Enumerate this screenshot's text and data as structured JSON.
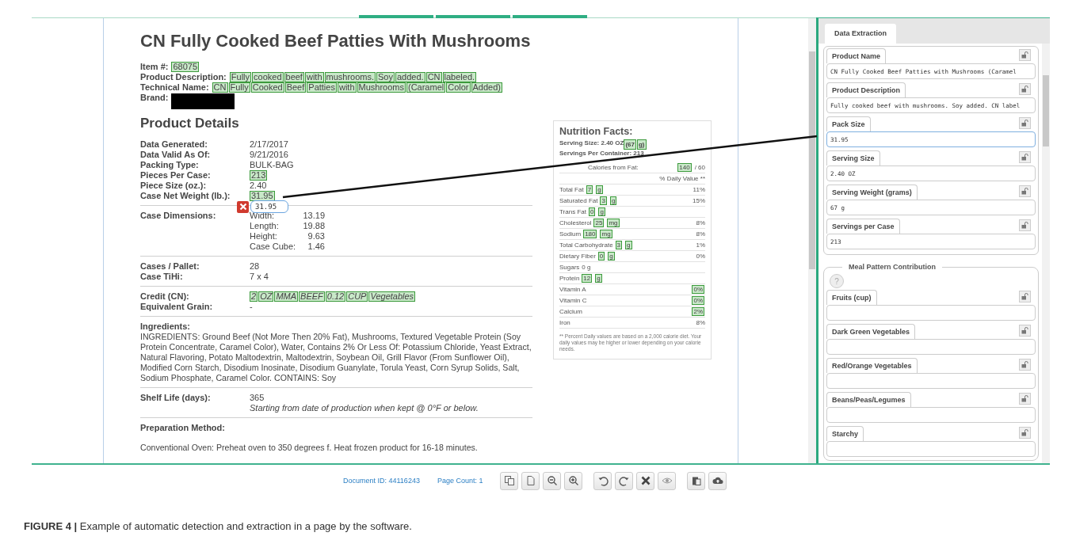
{
  "document": {
    "title": "CN Fully Cooked Beef Patties With Mushrooms",
    "identity": [
      {
        "label": "Item #:",
        "tokens": [
          "68075"
        ]
      },
      {
        "label": "Product Description:",
        "tokens": [
          "Fully",
          "cooked",
          "beef",
          "with",
          "mushrooms.",
          "Soy",
          "added.",
          "CN",
          "labeled."
        ]
      },
      {
        "label": "Technical Name:",
        "tokens": [
          "CN",
          "Fully",
          "Cooked",
          "Beef",
          "Patties",
          "with",
          "Mushrooms",
          "(Caramel",
          "Color",
          "Added)"
        ]
      },
      {
        "label": "Brand:",
        "redacted": true
      }
    ],
    "heading": "Product Details",
    "sections": [
      {
        "kind": "pairs",
        "rows": [
          {
            "label": "Data Generated:",
            "value": "2/17/2017",
            "highlighted": false
          },
          {
            "label": "Data Valid As Of:",
            "value": "9/21/2016",
            "highlighted": false
          },
          {
            "label": "Packing Type:",
            "value": "BULK-BAG",
            "highlighted": false
          },
          {
            "label": "Pieces Per Case:",
            "value": "213",
            "highlighted": true
          },
          {
            "label": "Piece Size (oz.):",
            "value": "2.40",
            "highlighted": false
          },
          {
            "label": "Case Net Weight (lb.):",
            "value": "31.95",
            "highlighted": true
          }
        ]
      },
      {
        "kind": "dimensions",
        "label": "Case Dimensions:",
        "dims": [
          {
            "label": "Width:",
            "value": "13.19"
          },
          {
            "label": "Length:",
            "value": "19.88"
          },
          {
            "label": "Height:",
            "value": "9.63"
          },
          {
            "label": "Case Cube:",
            "value": "1.46"
          }
        ]
      },
      {
        "kind": "pairs",
        "rows": [
          {
            "label": "Cases / Pallet:",
            "value": "28",
            "highlighted": false
          },
          {
            "label": "Case TiHi:",
            "value": "7 x 4",
            "highlighted": false
          }
        ]
      },
      {
        "kind": "pairs",
        "rows": [
          {
            "label": "Credit (CN):",
            "tokens": [
              "2",
              "OZ",
              "MMA",
              "BEEF",
              "0.12",
              "CUP",
              "Vegetables"
            ],
            "italic": true
          },
          {
            "label": "Equivalent Grain:",
            "value": "-",
            "highlighted": false
          }
        ]
      },
      {
        "kind": "paragraph",
        "label": "Ingredients:",
        "text": "INGREDIENTS: Ground Beef (Not More Then 20% Fat), Mushrooms, Textured Vegetable Protein (Soy Protein Concentrate, Caramel Color), Water, Contains 2% Or Less Of: Potassium Chloride, Yeast Extract, Natural Flavoring, Potato Maltodextrin, Maltodextrin, Soybean Oil, Grill Flavor (From Sunflower Oil), Modified Corn Starch, Disodium Inosinate, Disodium Guanylate, Torula Yeast, Corn Syrup Solids, Salt, Sodium Phosphate, Caramel Color. CONTAINS: Soy"
      },
      {
        "kind": "pairs",
        "rows": [
          {
            "label": "Shelf Life (days):",
            "value": "365",
            "highlighted": false,
            "note": "Starting from date of production when kept @ 0°F or below."
          }
        ]
      },
      {
        "kind": "paragraph",
        "label": "Preparation Method:",
        "text": "Conventional Oven: Preheat oven to 350 degrees f. Heat frozen product for 16-18 minutes."
      }
    ]
  },
  "nutrition": {
    "title": "Nutrition Facts:",
    "serving": {
      "text": "Serving Size: 2.40 OZ",
      "tokens": [
        "(67",
        "g)"
      ]
    },
    "servings_per_container": "Servings Per Container: 213",
    "calories": {
      "label": "Calories from Fat:",
      "tokens": [
        "140"
      ],
      "rest": "/ 60"
    },
    "dv_header": "% Daily Value **",
    "rows": [
      {
        "name": "Total Fat",
        "tokens": [
          "7",
          "g"
        ],
        "dv": "11%",
        "dv_highlighted": false
      },
      {
        "name": "Saturated Fat",
        "tokens": [
          "3",
          "g"
        ],
        "dv": "15%",
        "dv_highlighted": false
      },
      {
        "name": "Trans Fat",
        "tokens": [
          "0",
          "g"
        ]
      },
      {
        "name": "Cholesterol",
        "tokens": [
          "25",
          "mg"
        ],
        "dv": "8%",
        "dv_highlighted": false
      },
      {
        "name": "Sodium",
        "tokens": [
          "180",
          "mg"
        ],
        "dv": "8%",
        "dv_highlighted": false
      },
      {
        "name": "Total Carbohydrate",
        "tokens": [
          "3",
          "g"
        ],
        "dv": "1%",
        "dv_highlighted": false
      },
      {
        "name": "Dietary Fiber",
        "tokens": [
          "0",
          "g"
        ],
        "dv": "0%",
        "dv_highlighted": false
      },
      {
        "name": "Sugars",
        "amount": "0 g"
      },
      {
        "name": "Protein",
        "tokens": [
          "12",
          "g"
        ]
      },
      {
        "name": "Vitamin A",
        "dv": "0%",
        "dv_highlighted": true
      },
      {
        "name": "Vitamin C",
        "dv": "0%",
        "dv_highlighted": true
      },
      {
        "name": "Calcium",
        "dv": "2%",
        "dv_highlighted": true
      },
      {
        "name": "Iron",
        "dv": "8%",
        "dv_highlighted": false
      }
    ],
    "footnote": "** Percent Daily values are based on a 2,000 calorie diet. Your daily values may be higher or lower depending on your calorie needs."
  },
  "popup": {
    "value": "31.95"
  },
  "panel": {
    "tabs": [
      {
        "label": "Data Extraction",
        "selected": true
      }
    ],
    "fields": [
      {
        "label": "Product Name",
        "value": "CN Fully Cooked Beef Patties with Mushrooms (Caramel",
        "focused": false
      },
      {
        "label": "Product Description",
        "value": "Fully cooked beef with mushrooms. Soy added. CN label",
        "focused": false
      },
      {
        "label": "Pack Size",
        "value": "31.95",
        "focused": true
      },
      {
        "label": "Serving Size",
        "value": "2.40 OZ",
        "focused": false
      },
      {
        "label": "Serving Weight (grams)",
        "value": "67 g",
        "focused": false
      },
      {
        "label": "Servings per Case",
        "value": "213",
        "focused": false
      }
    ],
    "group": {
      "legend": "Meal Pattern Contribution",
      "help": "?",
      "fields": [
        {
          "label": "Fruits (cup)",
          "focused": false
        },
        {
          "label": "Dark Green Vegetables",
          "focused": false
        },
        {
          "label": "Red/Orange Vegetables",
          "focused": false
        },
        {
          "label": "Beans/Peas/Legumes",
          "focused": false
        },
        {
          "label": "Starchy",
          "focused": false
        }
      ]
    }
  },
  "toolbar": {
    "document_id": "Document ID: 44116243",
    "page_count": "Page Count: 1"
  },
  "caption": "**FIGURE 4 |** Example of automatic detection and extraction in a page by the software."
}
